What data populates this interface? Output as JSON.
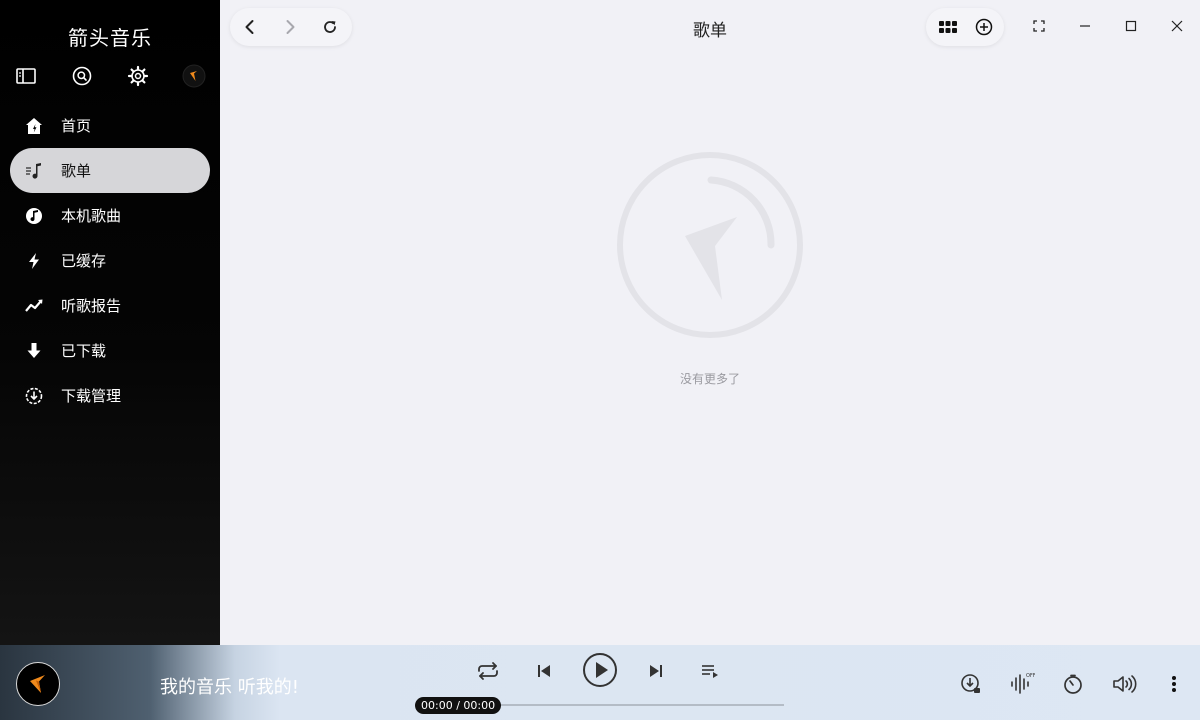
{
  "app": {
    "title": "箭头音乐"
  },
  "sidebar": {
    "top_icons": [
      "sidebar-toggle-icon",
      "search-icon",
      "gear-icon",
      "app-logo-icon"
    ],
    "items": [
      {
        "label": "首页",
        "icon": "home-icon",
        "active": false
      },
      {
        "label": "歌单",
        "icon": "playlist-icon",
        "active": true
      },
      {
        "label": "本机歌曲",
        "icon": "music-note-icon",
        "active": false
      },
      {
        "label": "已缓存",
        "icon": "lightning-icon",
        "active": false
      },
      {
        "label": "听歌报告",
        "icon": "trend-icon",
        "active": false
      },
      {
        "label": "已下载",
        "icon": "download-arrow-icon",
        "active": false
      },
      {
        "label": "下载管理",
        "icon": "download-manager-icon",
        "active": false
      }
    ]
  },
  "header": {
    "title": "歌单"
  },
  "main": {
    "empty_text": "没有更多了"
  },
  "player": {
    "slogan": "我的音乐 听我的!",
    "time": "00:00 / 00:00",
    "progress": 0
  },
  "colors": {
    "sidebar_bg": "#000000",
    "active_item_bg": "#d6d6d9",
    "main_bg": "#f1f1f6",
    "player_bg": "#dde7f3",
    "accent_orange": "#f08a1c"
  }
}
